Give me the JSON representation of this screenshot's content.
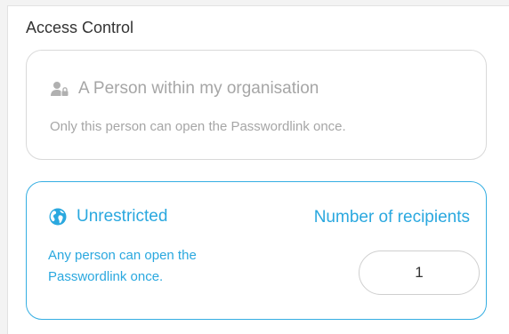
{
  "section": {
    "title": "Access Control"
  },
  "options": {
    "person": {
      "icon": "person-lock-icon",
      "title": "A Person within my organisation",
      "description": "Only this person can open the Passwordlink once.",
      "selected": false
    },
    "unrestricted": {
      "icon": "globe-icon",
      "title": "Unrestricted",
      "description": "Any person can open the Passwordlink once.",
      "selected": true,
      "recipients_label": "Number of recipients",
      "recipients_value": "1"
    }
  },
  "colors": {
    "accent": "#2aa8df",
    "muted": "#a6a6a6",
    "border_muted": "#d9d9d9",
    "border_selected": "#35aee2"
  }
}
